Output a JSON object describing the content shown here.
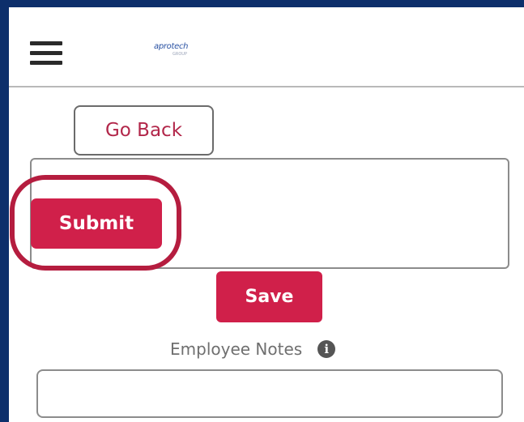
{
  "header": {
    "menu_icon": "hamburger-menu-icon",
    "logo_text": "aprotech",
    "logo_subtext": "GROUP"
  },
  "actions": {
    "go_back_label": "Go Back",
    "submit_label": "Submit",
    "save_label": "Save"
  },
  "notes": {
    "label": "Employee Notes",
    "info_icon": "info-icon",
    "value": "",
    "placeholder": ""
  },
  "colors": {
    "frame": "#0d2f6b",
    "primary": "#d0204a",
    "link_text": "#b2274a",
    "highlight_ring": "#b51d3f"
  }
}
